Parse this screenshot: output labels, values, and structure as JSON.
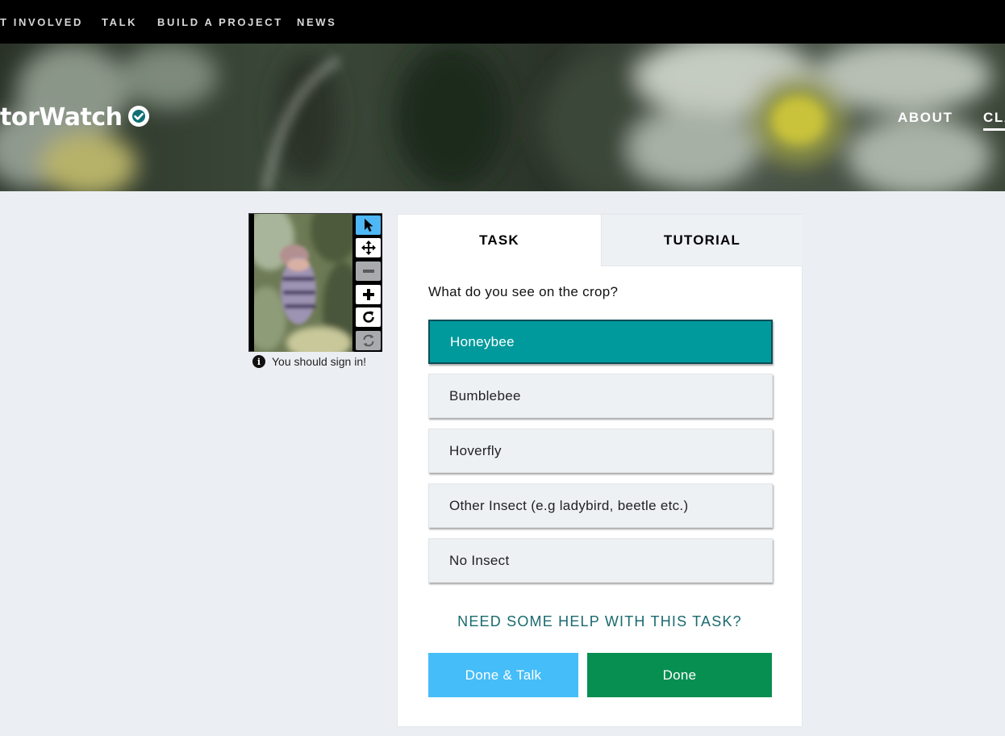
{
  "topnav": {
    "items": [
      {
        "label": "T INVOLVED"
      },
      {
        "label": "TALK"
      },
      {
        "label": "BUILD A PROJECT"
      },
      {
        "label": "NEWS"
      }
    ]
  },
  "hero": {
    "title": "torWatch",
    "links": [
      {
        "label": "ABOUT"
      },
      {
        "label": "CLA"
      }
    ]
  },
  "viewer": {
    "tools": [
      "pointer-icon",
      "move-icon",
      "zoom-out-icon",
      "zoom-in-icon",
      "rotate-icon",
      "reset-icon"
    ],
    "note": "You should sign in!"
  },
  "task": {
    "tabs": [
      {
        "label": "TASK"
      },
      {
        "label": "TUTORIAL"
      }
    ],
    "question": "What do you see on the crop?",
    "answers": [
      {
        "label": "Honeybee",
        "selected": true
      },
      {
        "label": "Bumblebee",
        "selected": false
      },
      {
        "label": "Hoverfly",
        "selected": false
      },
      {
        "label": "Other Insect (e.g ladybird, beetle etc.)",
        "selected": false
      },
      {
        "label": "No Insect",
        "selected": false
      }
    ],
    "help": "NEED SOME HELP WITH THIS TASK?",
    "buttons": {
      "done_talk": "Done & Talk",
      "done": "Done"
    }
  },
  "colors": {
    "selected_answer": "#009a9c",
    "done_talk": "#45bdf8",
    "done": "#078f52",
    "help_link": "#1a6a6e",
    "active_tool": "#4fb7f5"
  }
}
